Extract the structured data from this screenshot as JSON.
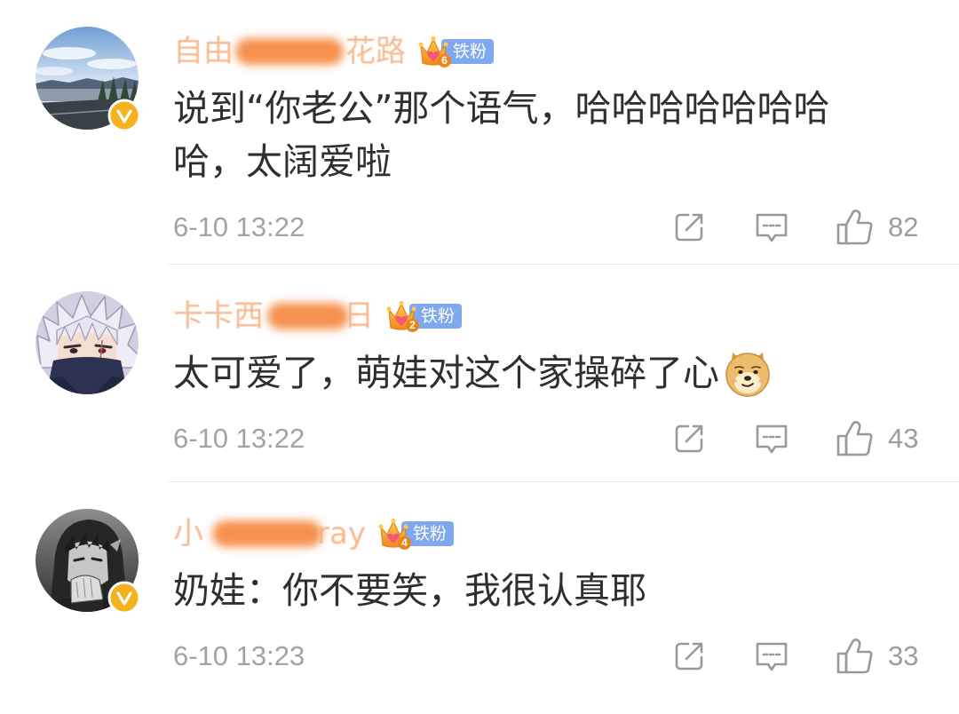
{
  "colors": {
    "text": "#2f2f2f",
    "meta": "#a3a3a3",
    "username": "#f6ad7c",
    "redaction": "#f5873f",
    "fan_badge_bg": "#80a8ee",
    "verified": "#f5b21c",
    "divider": "#e6e6e6"
  },
  "icons": {
    "share": "share-icon",
    "reply": "comment-icon",
    "like": "thumbs-up-icon",
    "verified": "verified-v-icon",
    "fan_badge": "crown-icon"
  },
  "comments": [
    {
      "name_prefix": "自由",
      "name_suffix": "花路",
      "verified": true,
      "fan_badge": {
        "level": "6",
        "label": "铁粉"
      },
      "content_lines": [
        "说到“你老公”那个语气，哈哈哈哈哈哈哈",
        "哈，太阔爱啦"
      ],
      "time": "6-10 13:22",
      "likes": "82"
    },
    {
      "name_prefix": "卡卡西",
      "name_suffix": "日",
      "verified": false,
      "fan_badge": {
        "level": "2",
        "label": "铁粉"
      },
      "content_lines": [
        "太可爱了，萌娃对这个家操碎了心"
      ],
      "emoji": "doge",
      "time": "6-10 13:22",
      "likes": "43"
    },
    {
      "name_prefix": "小",
      "name_suffix": "ray",
      "verified": true,
      "fan_badge": {
        "level": "4",
        "label": "铁粉"
      },
      "content_lines": [
        "奶娃：你不要笑，我很认真耶"
      ],
      "time": "6-10 13:23",
      "likes": "33"
    }
  ]
}
